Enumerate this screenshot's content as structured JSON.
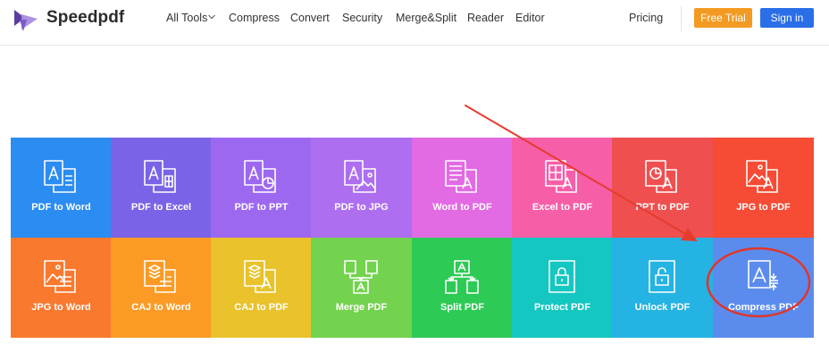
{
  "brand": {
    "name": "Speedpdf",
    "colors": {
      "logo_dark": "#5b3fa0",
      "logo_light": "#a98be0"
    }
  },
  "nav": {
    "items": [
      "All Tools",
      "Compress",
      "Convert",
      "Security",
      "Merge&Split",
      "Reader",
      "Editor"
    ],
    "pricing": "Pricing",
    "free_trial": "Free Trial",
    "sign_in": "Sign in"
  },
  "tools": [
    {
      "label": "PDF to Word",
      "icon": "pdf-to-word-icon",
      "color": "#2b8cf2"
    },
    {
      "label": "PDF to Excel",
      "icon": "pdf-to-excel-icon",
      "color": "#7a63e6"
    },
    {
      "label": "PDF to PPT",
      "icon": "pdf-to-ppt-icon",
      "color": "#9d68f0"
    },
    {
      "label": "PDF to JPG",
      "icon": "pdf-to-jpg-icon",
      "color": "#ad6ef0"
    },
    {
      "label": "Word to PDF",
      "icon": "word-to-pdf-icon",
      "color": "#e26ae3"
    },
    {
      "label": "Excel to PDF",
      "icon": "excel-to-pdf-icon",
      "color": "#f75ea8"
    },
    {
      "label": "PPT to PDF",
      "icon": "ppt-to-pdf-icon",
      "color": "#f04f4f"
    },
    {
      "label": "JPG to PDF",
      "icon": "jpg-to-pdf-icon",
      "color": "#f64b34"
    },
    {
      "label": "JPG to Word",
      "icon": "jpg-to-word-icon",
      "color": "#f9792e"
    },
    {
      "label": "CAJ to Word",
      "icon": "caj-to-word-icon",
      "color": "#fb9b25"
    },
    {
      "label": "CAJ to PDF",
      "icon": "caj-to-pdf-icon",
      "color": "#e9c22c"
    },
    {
      "label": "Merge PDF",
      "icon": "merge-pdf-icon",
      "color": "#73d24e"
    },
    {
      "label": "Split PDF",
      "icon": "split-pdf-icon",
      "color": "#2dca55"
    },
    {
      "label": "Protect PDF",
      "icon": "protect-pdf-icon",
      "color": "#14c7c0"
    },
    {
      "label": "Unlock PDF",
      "icon": "unlock-pdf-icon",
      "color": "#25b3e3"
    },
    {
      "label": "Compress PDF",
      "icon": "compress-pdf-icon",
      "color": "#5b8ced"
    }
  ],
  "annotation": {
    "arrow_color": "#e53c2f",
    "circle_color": "#e0352a"
  }
}
